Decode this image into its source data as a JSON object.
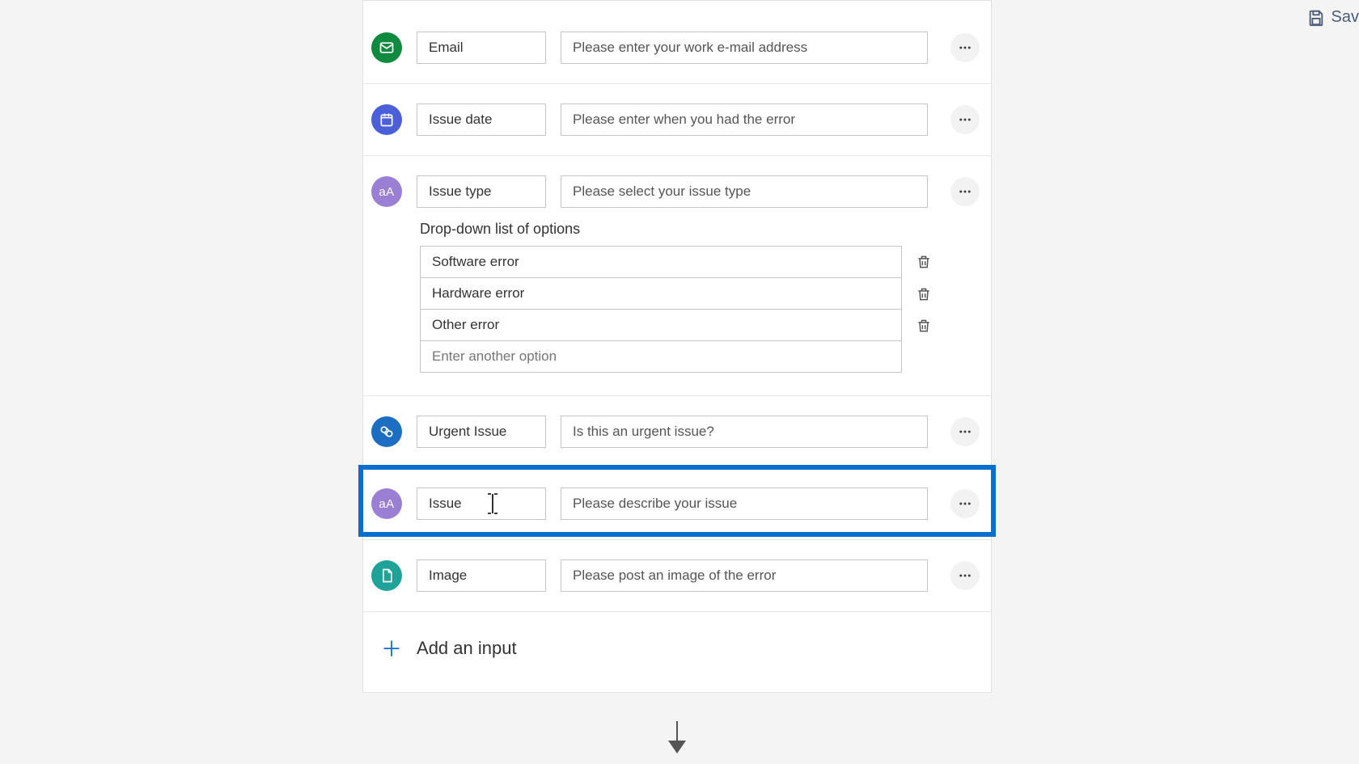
{
  "toolbar": {
    "save_label": "Sav"
  },
  "rows": {
    "email": {
      "name": "Email",
      "desc": "Please enter your work e-mail address"
    },
    "issue_date": {
      "name": "Issue date",
      "desc": "Please enter when you had the error"
    },
    "issue_type": {
      "name": "Issue type",
      "desc": "Please select your issue type"
    },
    "urgent": {
      "name": "Urgent Issue",
      "desc": "Is this an urgent issue?"
    },
    "issue": {
      "name": "Issue",
      "desc": "Please describe your issue"
    },
    "image": {
      "name": "Image",
      "desc": "Please post an image of the error"
    }
  },
  "dropdown": {
    "label": "Drop-down list of options",
    "options": [
      "Software error",
      "Hardware error",
      "Other error"
    ],
    "add_placeholder": "Enter another option"
  },
  "add_input_label": "Add an input",
  "icons": {
    "email": "email-icon",
    "date": "calendar-icon",
    "text": "text-aa-icon",
    "toggle": "toggle-icon",
    "file": "file-icon"
  },
  "badge_colors": {
    "email": "#0f8a3f",
    "date": "#4b5fd8",
    "text": "#9b7fd4",
    "toggle": "#1b6ec2",
    "file": "#1fa398"
  }
}
